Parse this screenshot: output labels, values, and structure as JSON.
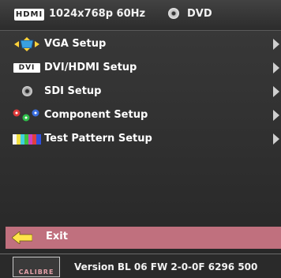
{
  "header": {
    "input_logo": "HDMI",
    "resolution": "1024x768p 60Hz",
    "source_icon": "disc-icon",
    "source_label": "DVD"
  },
  "menu": {
    "items": [
      {
        "label": "VGA Setup",
        "icon": "vga-connector-icon",
        "has_submenu": true
      },
      {
        "label": "DVI/HDMI Setup",
        "icon": "dvi-icon",
        "icon_text": "DVI",
        "has_submenu": true
      },
      {
        "label": "SDI Setup",
        "icon": "sdi-connector-icon",
        "has_submenu": true
      },
      {
        "label": "Component Setup",
        "icon": "component-rgb-icon",
        "has_submenu": true
      },
      {
        "label": "Test Pattern Setup",
        "icon": "test-pattern-icon",
        "has_submenu": true
      }
    ],
    "exit_label": "Exit",
    "exit_icon": "back-arrow-icon"
  },
  "footer": {
    "brand": "CALIBRE",
    "version": "Version BL 06 FW 2-0-0F  6296 500"
  },
  "colors": {
    "background": "#2b2b2b",
    "exit_highlight": "#c0707e",
    "text": "#ffffff"
  }
}
